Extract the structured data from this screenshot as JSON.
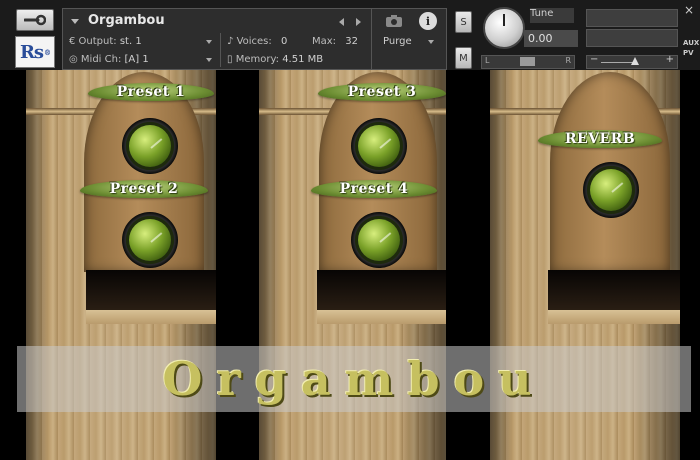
{
  "instrument": {
    "name": "Orgambou",
    "output_label": "Output:",
    "output_value": "st. 1",
    "voices_label": "Voices:",
    "voices_value": "0",
    "max_label": "Max:",
    "max_value": "32",
    "purge_label": "Purge",
    "midi_label": "Midi Ch:",
    "midi_value": "[A]  1",
    "memory_label": "Memory:",
    "memory_value": "4.51 MB",
    "info_glyph": "i"
  },
  "controls": {
    "solo_label": "S",
    "mute_label": "M",
    "tune_label": "Tune",
    "tune_value": "0.00",
    "pan_left": "L",
    "pan_right": "R",
    "vol_minus": "−",
    "vol_plus": "+",
    "aux_label": "AUX",
    "pv_label": "PV",
    "close_glyph": "×"
  },
  "logo_text": "Rs",
  "presets": [
    {
      "label": "Preset 1"
    },
    {
      "label": "Preset 2"
    },
    {
      "label": "Preset 3"
    },
    {
      "label": "Preset 4"
    }
  ],
  "reverb_label": "REVERB",
  "banner_title": "Orgambou",
  "icons": [
    "wrench-icon",
    "camera-icon",
    "info-icon",
    "close-icon",
    "speaker-icon",
    "midi-icon",
    "memory-icon"
  ]
}
